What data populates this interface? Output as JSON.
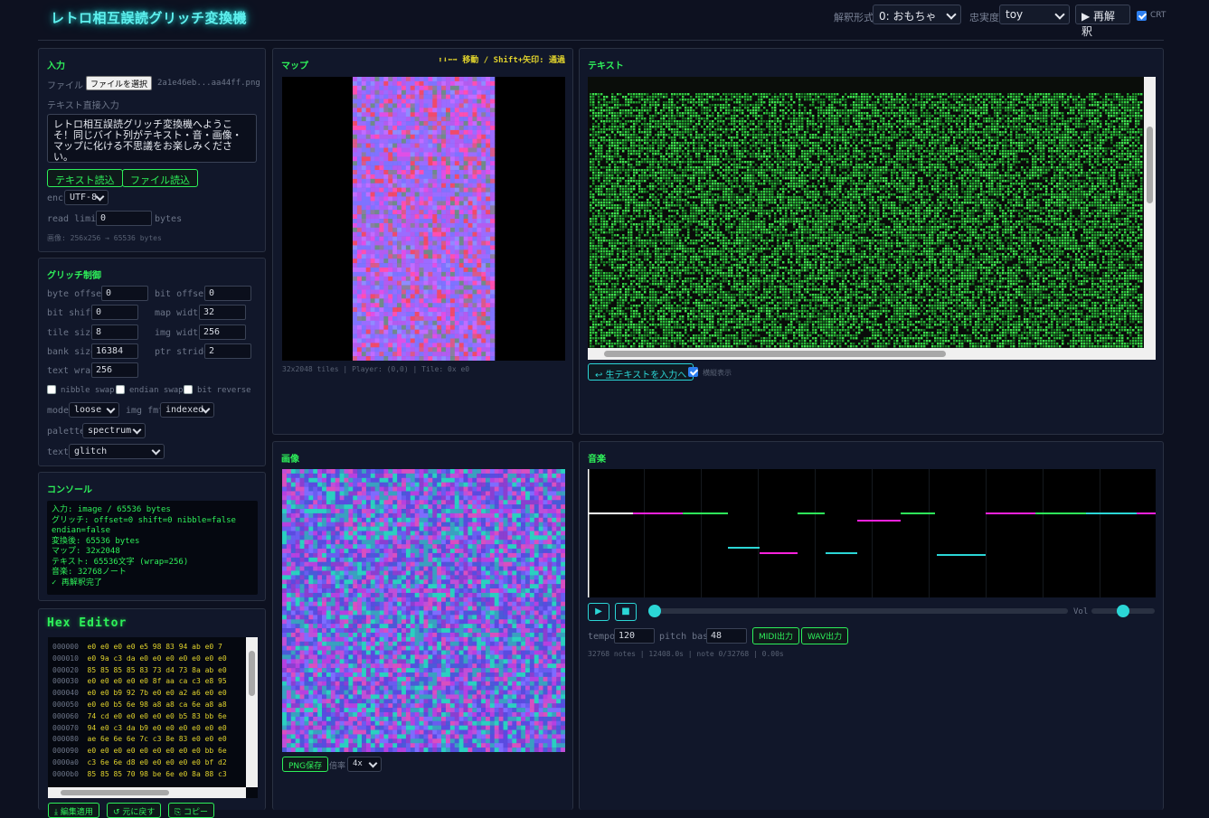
{
  "header": {
    "title": "レトロ相互誤読グリッチ変換機",
    "mode_label": "解釈形式",
    "mode_value": "0: おもちゃ",
    "fidelity_label": "忠実度",
    "fidelity_value": "toy",
    "reinterpret_label": "▶ 再解釈",
    "crt_label": "CRT"
  },
  "input_panel": {
    "title": "入力",
    "file_label": "ファイル",
    "file_button": "ファイルを選択",
    "file_name": "2a1e46eb...aa44ff.png",
    "text_input_label": "テキスト直接入力",
    "text_value": "レトロ相互誤読グリッチ変換機へようこそ！同じバイト列がテキスト・音・画像・マップに化ける不思議をお楽しみください。",
    "load_text_button": "テキスト読込",
    "load_file_button": "ファイル読込",
    "enc_label": "enc",
    "enc_value": "UTF-8",
    "read_limit_label": "read limit",
    "read_limit_value": "0",
    "read_limit_unit": "bytes",
    "image_info": "画像: 256x256 → 65536 bytes"
  },
  "glitch_panel": {
    "title": "グリッチ制御",
    "fields": {
      "byte_offset": {
        "label": "byte offset",
        "value": "0"
      },
      "bit_offset": {
        "label": "bit offset",
        "value": "0"
      },
      "bit_shift": {
        "label": "bit shift",
        "value": "0"
      },
      "map_width": {
        "label": "map width",
        "value": "32"
      },
      "tile_size": {
        "label": "tile size",
        "value": "8"
      },
      "img_width": {
        "label": "img width",
        "value": "256"
      },
      "bank_size": {
        "label": "bank size",
        "value": "16384"
      },
      "ptr_stride": {
        "label": "ptr stride",
        "value": "2"
      },
      "text_wrap": {
        "label": "text wrap",
        "value": "256"
      }
    },
    "nibble_swap": "nibble swap",
    "endian_swap": "endian swap",
    "bit_reverse": "bit reverse",
    "mode_label": "mode",
    "mode_value": "loose",
    "img_fmt_label": "img fmt",
    "img_fmt_value": "indexed",
    "palette_label": "palette",
    "palette_value": "spectrum",
    "text_label": "text",
    "text_value": "glitch"
  },
  "console_panel": {
    "title": "コンソール",
    "lines": [
      "入力: image / 65536 bytes",
      "グリッチ: offset=0 shift=0 nibble=false",
      "endian=false",
      "変換後: 65536 bytes",
      "マップ: 32x2048",
      "テキスト: 65536文字 (wrap=256)",
      "音楽: 32768ノート",
      "✓ 再解釈完了"
    ]
  },
  "hex_panel": {
    "title": "Hex Editor",
    "rows": [
      {
        "addr": "000000",
        "bytes": "e0 e0 e0 e0 e5 98 83 94 ab e0 7"
      },
      {
        "addr": "000010",
        "bytes": "e0 9a c3 da e0 e0 e0 e0 e0 e0 e0"
      },
      {
        "addr": "000020",
        "bytes": "85 85 85 85 83 73 d4 73 8a ab e0"
      },
      {
        "addr": "000030",
        "bytes": "e0 e0 e0 e0 e0 8f aa ca c3 e8 95"
      },
      {
        "addr": "000040",
        "bytes": "e0 e0 b9 92 7b e0 e0 a2 a6 e0 e0"
      },
      {
        "addr": "000050",
        "bytes": "e0 e0 b5 6e 98 a8 a8 ca 6e a8 a8"
      },
      {
        "addr": "000060",
        "bytes": "74 cd e0 e0 e0 e0 e0 b5 83 bb 6e"
      },
      {
        "addr": "000070",
        "bytes": "94 e0 c3 da b9 e0 e0 e0 e0 e0 e0"
      },
      {
        "addr": "000080",
        "bytes": "ae 6e 6e 6e 7c c3 8e 83 e0 e0 e0"
      },
      {
        "addr": "000090",
        "bytes": "e0 e0 e0 e0 e0 e0 e0 e0 e0 bb 6e"
      },
      {
        "addr": "0000a0",
        "bytes": "c3 6e 6e d8 e0 e0 e0 e0 e0 bf d2"
      },
      {
        "addr": "0000b0",
        "bytes": "85 85 85 70 98 be 6e e0 8a 88 c3"
      }
    ],
    "buttons": [
      "⤓ 編集適用",
      "↺ 元に戻す",
      "⎘ コピー"
    ]
  },
  "map_panel": {
    "title": "マップ",
    "controls_hint": "⬆⬇⬅➡ 移動 / Shift+矢印: 通過",
    "status": "32x2048 tiles | Player: (0,0) | Tile: 0x e0"
  },
  "text_panel": {
    "title": "テキスト",
    "raw_button": "↩ 生テキストを入力へ",
    "wrap_label": "横縦表示"
  },
  "image_panel": {
    "title": "画像",
    "save_button": "PNG保存",
    "scale_label": "倍率",
    "scale_value": "4x"
  },
  "music_panel": {
    "title": "音楽",
    "play_icon": "▶",
    "stop_icon": "■",
    "vol_label": "Vol",
    "vol_level": 0.5,
    "seek_level": 0.0,
    "tempo_label": "tempo",
    "tempo_value": "120",
    "pitch_label": "pitch base",
    "pitch_value": "48",
    "midi_button": "MIDI出力",
    "wav_button": "WAV出力",
    "status": "32768 notes | 12408.0s | note 0/32768 | 0.00s"
  },
  "colors": {
    "accent_green": "#2ef05a",
    "accent_cyan": "#2bd6d6",
    "note_magenta": "#ff22dd",
    "hex_yellow": "#e0d22c"
  }
}
